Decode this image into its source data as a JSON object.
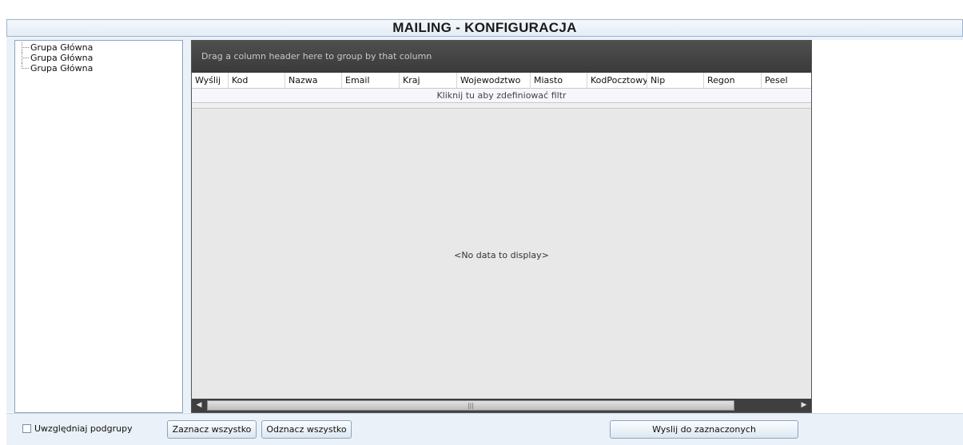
{
  "header": {
    "title": "MAILING - KONFIGURACJA"
  },
  "tree": {
    "items": [
      {
        "label": "Grupa Główna"
      },
      {
        "label": "Grupa Główna"
      },
      {
        "label": "Grupa Główna"
      }
    ]
  },
  "grid": {
    "group_panel_text": "Drag a column header here to group by that column",
    "columns": [
      "Wyślij",
      "Kod",
      "Nazwa",
      "Email",
      "Kraj",
      "Wojewodztwo",
      "Miasto",
      "KodPocztowy",
      "Nip",
      "Regon",
      "Pesel"
    ],
    "filter_text": "Kliknij tu aby zdefiniować filtr",
    "empty_text": "<No data to display>",
    "scroll_left_icon": "arrow-left-icon",
    "scroll_right_icon": "arrow-right-icon",
    "scroll_grip_icon": "grip-icon"
  },
  "footer": {
    "include_subgroups_label": "Uwzględniaj podgrupy",
    "include_subgroups_checked": false,
    "select_all_label": "Zaznacz wszystko",
    "deselect_all_label": "Odznacz wszystko",
    "send_selected_label": "Wyslij do zaznaczonych"
  },
  "colors": {
    "title_bar_bg": "#e3ecf5",
    "workspace_bg": "#eaf1f8",
    "group_panel_bg": "#444444",
    "grid_body_bg": "#e8e8e8",
    "border": "#8ea4bd"
  }
}
